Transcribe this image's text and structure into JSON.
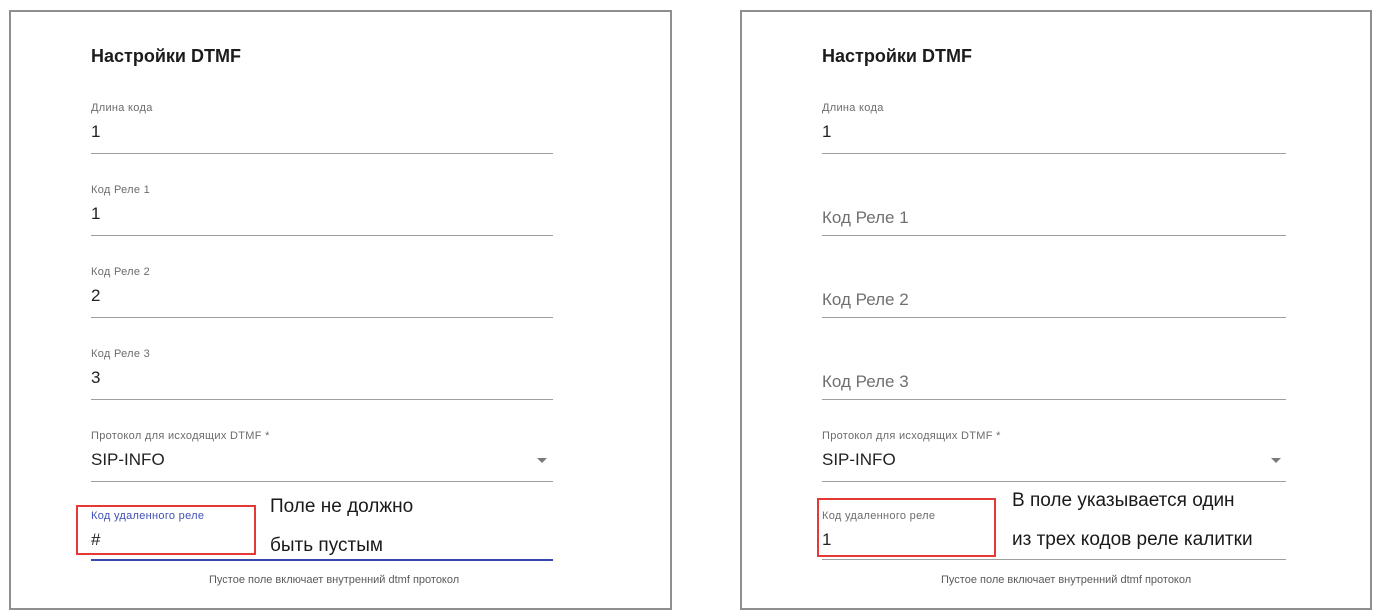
{
  "left": {
    "title": "Настройки DTMF",
    "code_length": {
      "label": "Длина кода",
      "value": "1"
    },
    "relay1": {
      "label": "Код Реле 1",
      "value": "1"
    },
    "relay2": {
      "label": "Код Реле 2",
      "value": "2"
    },
    "relay3": {
      "label": "Код Реле 3",
      "value": "3"
    },
    "protocol": {
      "label": "Протокол для исходящих DTMF *",
      "value": "SIP-INFO"
    },
    "remote_relay": {
      "label": "Код удаленного реле",
      "value": "#"
    },
    "hint": "Пустое поле включает внутренний dtmf протокол",
    "annotation": [
      "Поле не должно",
      "быть пустым"
    ]
  },
  "right": {
    "title": "Настройки DTMF",
    "code_length": {
      "label": "Длина кода",
      "value": "1"
    },
    "relay1": {
      "placeholder": "Код Реле 1"
    },
    "relay2": {
      "placeholder": "Код Реле 2"
    },
    "relay3": {
      "placeholder": "Код Реле 3"
    },
    "protocol": {
      "label": "Протокол для исходящих DTMF *",
      "value": "SIP-INFO"
    },
    "remote_relay": {
      "label": "Код удаленного реле",
      "value": "1"
    },
    "hint": "Пустое поле включает внутренний dtmf протокол",
    "annotation": [
      "В поле указывается один",
      "из трех кодов реле калитки"
    ]
  },
  "colors": {
    "highlight_box": "#e53935",
    "focus_underline": "#3949ab",
    "focus_label": "#3f51b5"
  }
}
